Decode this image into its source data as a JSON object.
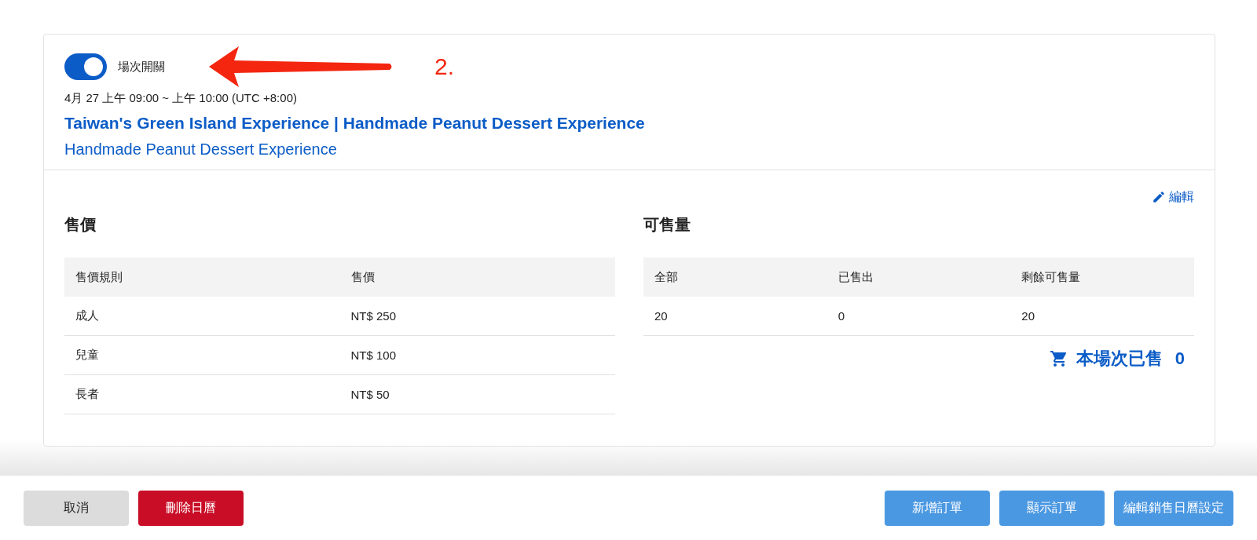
{
  "session": {
    "toggle": {
      "label": "場次開關",
      "on": true
    },
    "time": "4月 27 上午 09:00 ~ 上午 10:00 (UTC +8:00)",
    "title": "Taiwan's Green Island Experience | Handmade Peanut Dessert Experience",
    "subtitle": "Handmade Peanut Dessert Experience"
  },
  "annotation": {
    "label": "2."
  },
  "edit_link": "編輯",
  "price": {
    "heading": "售價",
    "columns": [
      "售價規則",
      "售價"
    ],
    "rows": [
      [
        "成人",
        "NT$ 250"
      ],
      [
        "兒童",
        "NT$ 100"
      ],
      [
        "長者",
        "NT$ 50"
      ]
    ]
  },
  "quantity": {
    "heading": "可售量",
    "columns": [
      "全部",
      "已售出",
      "剩餘可售量"
    ],
    "rows": [
      [
        "20",
        "0",
        "20"
      ]
    ],
    "sold_label": "本場次已售",
    "sold_count": "0"
  },
  "buttons": [
    {
      "label": "取消",
      "kind": "secondary"
    },
    {
      "label": "刪除日曆",
      "kind": "danger"
    },
    {
      "label": "新增訂單",
      "kind": "primary"
    },
    {
      "label": "顯示訂單",
      "kind": "primary"
    },
    {
      "label": "編輯銷售日曆設定",
      "kind": "primary"
    }
  ]
}
